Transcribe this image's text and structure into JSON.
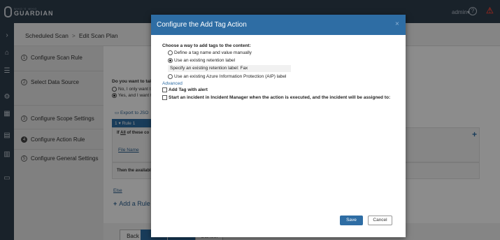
{
  "brand": {
    "small": "WHO'S WHO",
    "name": "GUARDIAN"
  },
  "header": {
    "user": "admin",
    "user_caret": "▾"
  },
  "breadcrumb": {
    "item1": "Scheduled Scan",
    "separator": ">",
    "item2": "Edit Scan Plan"
  },
  "steps": [
    {
      "num": "1",
      "label": "Configure Scan Rule"
    },
    {
      "num": "2",
      "label": "Select Data Source"
    },
    {
      "num": "3",
      "label": "Configure Scope Settings"
    },
    {
      "num": "4",
      "label": "Configure Action Rule"
    },
    {
      "num": "5",
      "label": "Configure General Settings"
    }
  ],
  "content": {
    "question": "Do you want to tak",
    "option1": "No, I only want t",
    "option2": "Yes, and I want t",
    "export": "Export to JSO",
    "rule_num": "1",
    "rule_label": "Rule 1",
    "cond_prefix": "If",
    "cond_all": "All",
    "cond_rest": "of these co",
    "cond_links": "File  Name  ",
    "then_text": "Then the availabl",
    "else_link": "Else",
    "add_rule": "Add a Rule"
  },
  "footer": {
    "back": "Back",
    "cancel": "Cancel"
  },
  "modal": {
    "title": "Configure the Add Tag Action",
    "close": "×",
    "question": "Choose a way to add tags to the content:",
    "opt_manual": "Define a tag name and value manually",
    "opt_retention": "Use an existing retention label",
    "retention_sub_label": "Specify an existing retention label:",
    "retention_value": "Fax",
    "opt_aip": "Use an existing Azure Information Protection (AIP) label",
    "advanced": "Advanced",
    "chk_alert": "Add Tag with alert",
    "chk_incident": "Start an incident in Incident Manager when the action is executed, and the incident will be assigned to:",
    "save": "Save",
    "cancel": "Cancel"
  },
  "colors": {
    "accent": "#2e6da4",
    "nav": "#2f3e4e",
    "warning": "#e2453a"
  }
}
